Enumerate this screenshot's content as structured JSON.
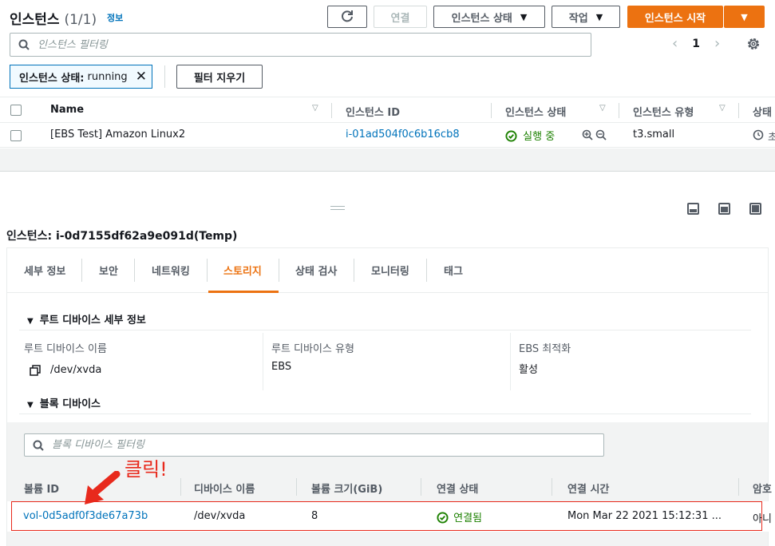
{
  "header": {
    "title": "인스턴스",
    "count": "(1/1)",
    "info_link": "정보",
    "refresh_icon": "refresh-icon",
    "connect_label": "연결",
    "instance_state_label": "인스턴스 상태",
    "actions_label": "작업",
    "launch_label": "인스턴스 시작"
  },
  "filter": {
    "placeholder": "인스턴스 필터링",
    "page": "1",
    "token_key": "인스턴스 상태:",
    "token_value": "running",
    "clear_label": "필터 지우기"
  },
  "instances_table": {
    "columns": [
      "Name",
      "인스턴스 ID",
      "인스턴스 상태",
      "인스턴스 유형",
      "상태"
    ],
    "rows": [
      {
        "name": "[EBS Test] Amazon Linux2",
        "instance_id": "i-01ad504f0c6b16cb8",
        "state": "실행 중",
        "type": "t3.small",
        "status": "초"
      }
    ]
  },
  "detail": {
    "title": "인스턴스: i-0d7155df62a9e091d(Temp)",
    "tabs": [
      "세부 정보",
      "보안",
      "네트워킹",
      "스토리지",
      "상태 검사",
      "모니터링",
      "태그"
    ],
    "active_tab": "스토리지"
  },
  "root_device": {
    "section_title": "루트 디바이스 세부 정보",
    "name_label": "루트 디바이스 이름",
    "name_value": "/dev/xvda",
    "type_label": "루트 디바이스 유형",
    "type_value": "EBS",
    "ebs_opt_label": "EBS 최적화",
    "ebs_opt_value": "활성"
  },
  "block_devices": {
    "section_title": "블록 디바이스",
    "filter_placeholder": "블록 디바이스 필터링",
    "columns": [
      "볼륨 ID",
      "디바이스 이름",
      "볼륨 크기(GiB)",
      "연결 상태",
      "연결 시간",
      "암호"
    ],
    "rows": [
      {
        "volume_id": "vol-0d5adf0f3de67a73b",
        "device": "/dev/xvda",
        "size": "8",
        "attach_state": "연결됨",
        "attach_time": "Mon Mar 22 2021 15:12:31 ...",
        "encrypted": "아니"
      }
    ]
  },
  "annotation": {
    "text": "클릭!"
  },
  "colors": {
    "accent": "#ec7211",
    "link": "#0073bb",
    "success": "#1d8102",
    "annotation_red": "#e8291c"
  }
}
